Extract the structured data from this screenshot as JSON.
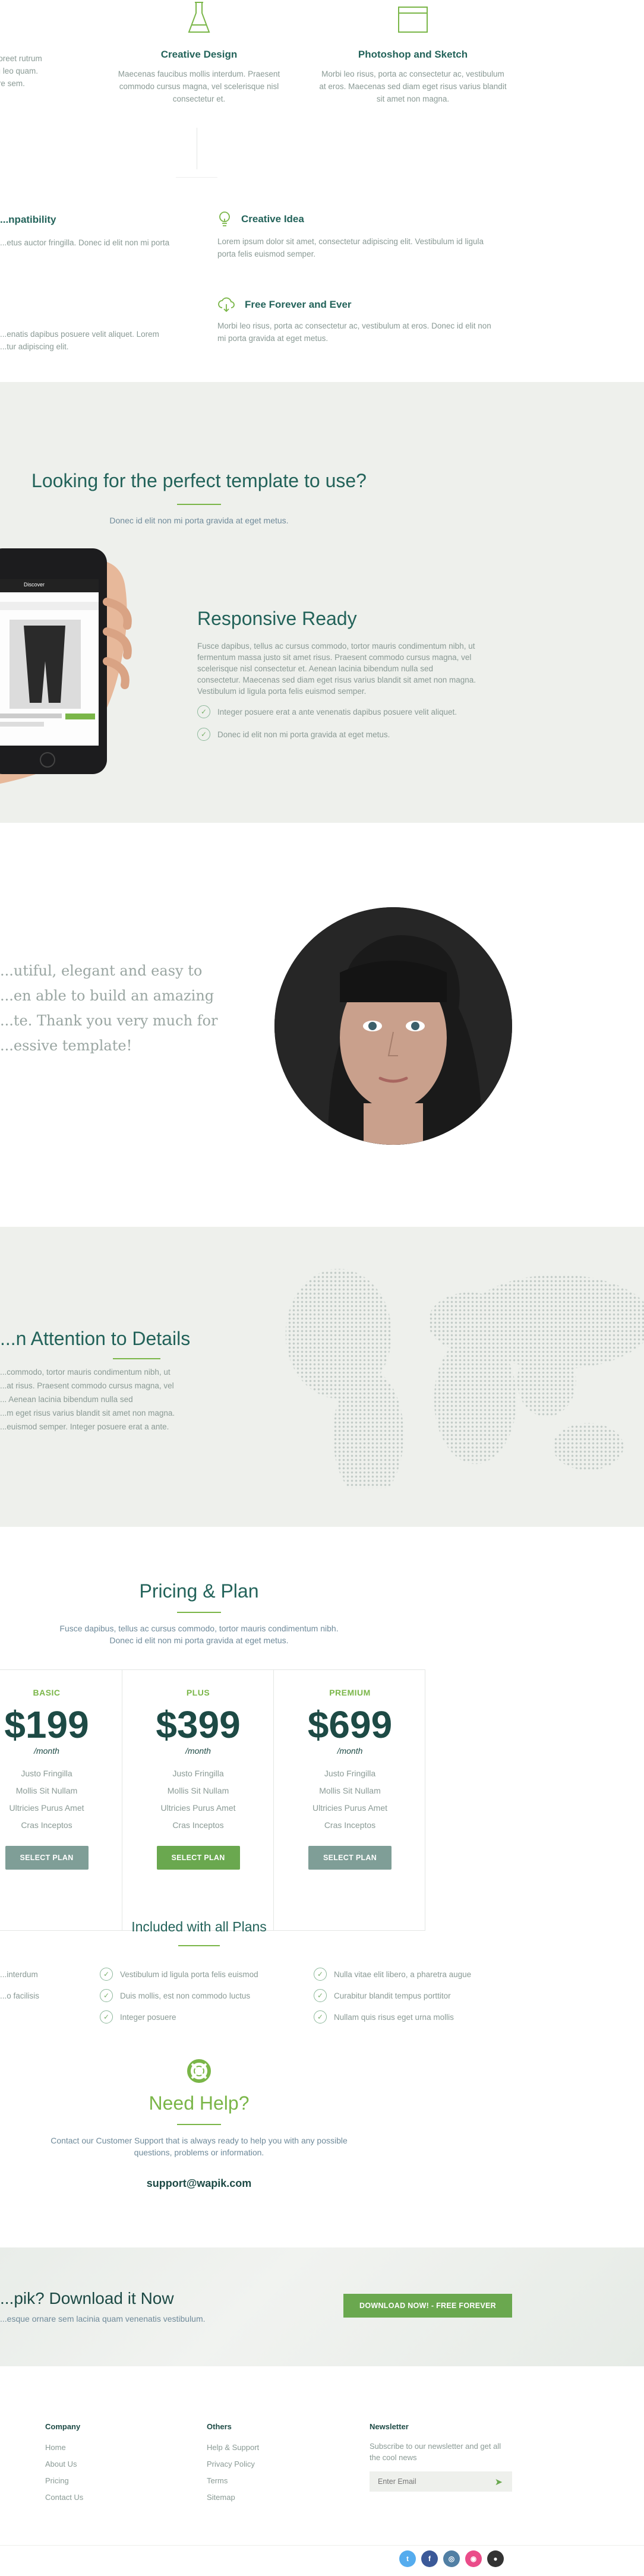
{
  "features": [
    {
      "title": "",
      "text": [
        "...gue laoreet rutrum",
        "...en eu leo quam.",
        "...are sem."
      ]
    },
    {
      "title": "Creative Design",
      "text": [
        "Maecenas faucibus mollis interdum. Praesent",
        "commodo cursus magna, vel scelerisque nisl",
        "consectetur et."
      ]
    },
    {
      "title": "Photoshop and Sketch",
      "text": [
        "Morbi leo risus, porta ac consectetur ac, vestibulum",
        "at eros. Maecenas sed diam eget risus varius blandit",
        "sit amet non magna."
      ]
    },
    {
      "title": "...npatibility",
      "text": [
        "...etus auctor fringilla. Donec id elit non mi porta"
      ]
    },
    {
      "title": "Creative Idea",
      "text": [
        "Lorem ipsum dolor sit amet, consectetur adipiscing elit. Vestibulum id ligula",
        "porta felis euismod semper."
      ]
    },
    {
      "title": "Free Forever and Ever",
      "text": [
        "Morbi leo risus, porta ac consectetur ac, vestibulum at eros. Donec id elit non",
        "mi porta gravida at eget metus."
      ]
    },
    {
      "title": "",
      "text": [
        "...enatis dapibus posuere velit aliquet. Lorem",
        "...tur adipiscing elit."
      ]
    }
  ],
  "template": {
    "heading": "Looking for the perfect template to use?",
    "sub": "Donec id elit non mi porta gravida at eget metus.",
    "responsive_title": "Responsive Ready",
    "responsive_text": [
      "Fusce dapibus, tellus ac cursus commodo, tortor mauris condimentum nibh, ut",
      "fermentum massa justo sit amet risus. Praesent commodo cursus magna, vel",
      "scelerisque nisl consectetur et. Aenean lacinia bibendum nulla sed",
      "consectetur. Maecenas sed diam eget risus varius blandit sit amet non magna.",
      "Vestibulum id ligula porta felis euismod semper."
    ],
    "checks": [
      "Integer posuere erat a ante venenatis dapibus posuere velit aliquet.",
      "Donec id elit non mi porta gravida at eget metus."
    ],
    "phone_label": "Discover"
  },
  "testimonial": {
    "lines": [
      "...utiful, elegant and easy to",
      "...en able to build an amazing",
      "...te. Thank you very much for",
      "...essive template!"
    ]
  },
  "attention": {
    "title": "...n Attention to Details",
    "text": [
      "...commodo, tortor mauris condimentum nibh, ut",
      "...at risus. Praesent commodo cursus magna, vel",
      "... Aenean lacinia bibendum nulla sed",
      "...m eget risus varius blandit sit amet non magna.",
      "...euismod semper. Integer posuere erat a ante."
    ]
  },
  "pricing": {
    "title": "Pricing & Plan",
    "sub": [
      "Fusce dapibus, tellus ac cursus commodo, tortor mauris condimentum nibh.",
      "Donec id elit non mi porta gravida at eget metus."
    ],
    "plans": [
      {
        "name": "BASIC",
        "price": "$199",
        "per": "/month",
        "items": [
          "Justo Fringilla",
          "Mollis Sit Nullam",
          "Ultricies Purus Amet",
          "Cras Inceptos"
        ],
        "button": "SELECT PLAN",
        "accent": "#7f9e97"
      },
      {
        "name": "PLUS",
        "price": "$399",
        "per": "/month",
        "items": [
          "Justo Fringilla",
          "Mollis Sit Nullam",
          "Ultricies Purus Amet",
          "Cras Inceptos"
        ],
        "button": "SELECT PLAN",
        "accent": "#6aa84f"
      },
      {
        "name": "PREMIUM",
        "price": "$699",
        "per": "/month",
        "items": [
          "Justo Fringilla",
          "Mollis Sit Nullam",
          "Ultricies Purus Amet",
          "Cras Inceptos"
        ],
        "button": "SELECT PLAN",
        "accent": "#7f9e97"
      }
    ]
  },
  "included": {
    "title": "Included with all Plans",
    "col1": [
      "...interdum",
      "...o facilisis"
    ],
    "col2": [
      "Vestibulum id ligula porta felis euismod",
      "Duis mollis, est non commodo luctus",
      "Integer posuere"
    ],
    "col3": [
      "Nulla vitae elit libero, a pharetra augue",
      "Curabitur blandit tempus porttitor",
      "Nullam quis risus eget urna mollis"
    ]
  },
  "help": {
    "title": "Need Help?",
    "text": [
      "Contact our Customer Support that is always ready to help you with any possible",
      "questions, problems or information."
    ],
    "email": "support@wapik.com"
  },
  "download": {
    "title": "...pik? Download it Now",
    "sub": "...esque ornare sem lacinia quam venenatis vestibulum.",
    "button": "DOWNLOAD NOW! - FREE FOREVER"
  },
  "footer": {
    "company": {
      "title": "Company",
      "links": [
        "Home",
        "About Us",
        "Pricing",
        "Contact Us"
      ]
    },
    "others": {
      "title": "Others",
      "links": [
        "Help & Support",
        "Privacy Policy",
        "Terms",
        "Sitemap"
      ]
    },
    "newsletter": {
      "title": "Newsletter",
      "text": [
        "Subscribe to our newsletter and get all",
        "the cool news"
      ],
      "placeholder": "Enter Email"
    }
  },
  "social": [
    {
      "icon": "twitter-icon",
      "glyph": "t",
      "color": "#55acee"
    },
    {
      "icon": "facebook-icon",
      "glyph": "f",
      "color": "#3b5998"
    },
    {
      "icon": "instagram-icon",
      "glyph": "◎",
      "color": "#517fa4"
    },
    {
      "icon": "dribbble-icon",
      "glyph": "◉",
      "color": "#ea4c89"
    },
    {
      "icon": "github-icon",
      "glyph": "●",
      "color": "#333333"
    }
  ]
}
